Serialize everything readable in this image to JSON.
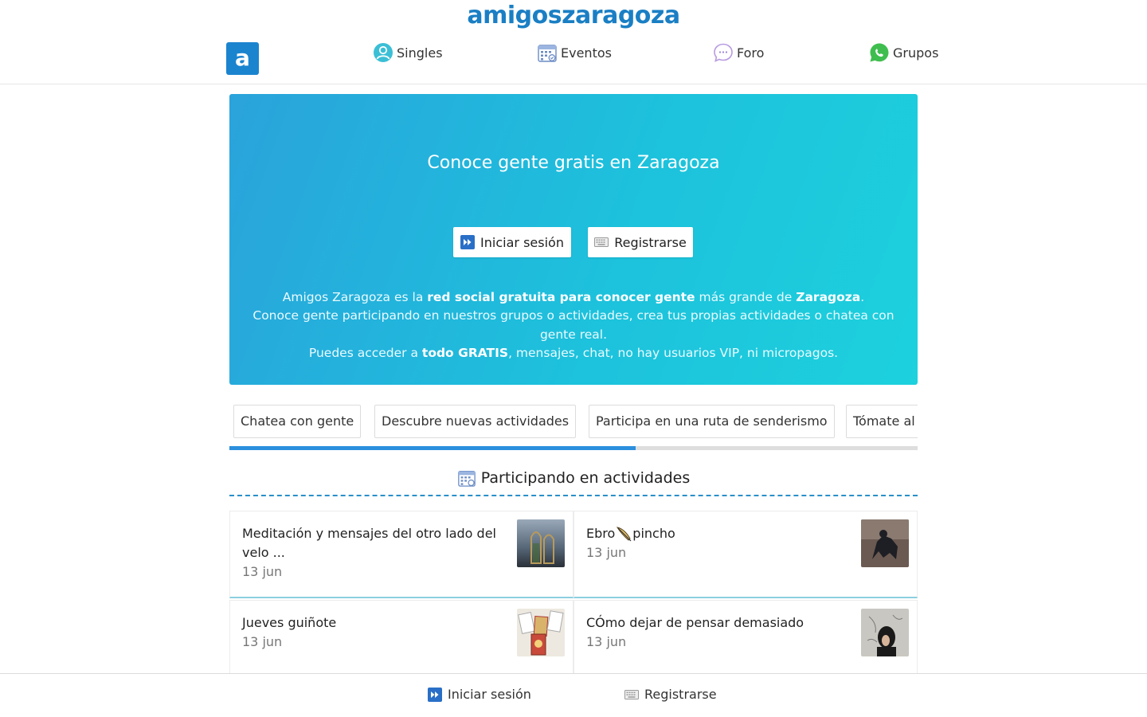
{
  "header": {
    "brand": "amigoszaragoza",
    "logo_letter": "a",
    "nav": [
      {
        "label": "Singles",
        "icon": "user-circle-icon"
      },
      {
        "label": "Eventos",
        "icon": "calendar-icon"
      },
      {
        "label": "Foro",
        "icon": "chat-bubble-icon"
      },
      {
        "label": "Grupos",
        "icon": "whatsapp-icon"
      }
    ]
  },
  "hero": {
    "title": "Conoce gente gratis en Zaragoza",
    "login_label": "Iniciar sesión",
    "register_label": "Registrarse",
    "line1_a": "Amigos Zaragoza es la ",
    "line1_b": "red social gratuita para conocer gente",
    "line1_c": " más grande de ",
    "line1_d": "Zaragoza",
    "line1_e": ".",
    "line2": "Conoce gente participando en nuestros grupos o actividades, crea tus propias actividades o chatea con gente real.",
    "line3_a": "Puedes acceder a ",
    "line3_b": "todo GRATIS",
    "line3_c": ", mensajes, chat, no hay usuarios VIP, ni micropagos."
  },
  "tags": [
    "Chatea con gente",
    "Descubre nuevas actividades",
    "Participa en una ruta de senderismo",
    "Tómate al"
  ],
  "carousel_progress": 0.59,
  "section": {
    "title": "Participando en actividades"
  },
  "activities": [
    {
      "title": "Meditación y mensajes del otro lado del velo ...",
      "date": "13 jun"
    },
    {
      "title": "Ebro",
      "title_after": "pincho",
      "date": "13 jun"
    },
    {
      "title": "Jueves guiñote",
      "date": "13 jun"
    },
    {
      "title": "CÓmo dejar de pensar demasiado",
      "date": "13 jun"
    }
  ],
  "bottom_bar": {
    "login_label": "Iniciar sesión",
    "register_label": "Registrarse"
  },
  "colors": {
    "brand": "#1a7fc4",
    "hero_start": "#2aa3db",
    "hero_end": "#1dd1dd",
    "accent_line": "#2a8fc9"
  }
}
